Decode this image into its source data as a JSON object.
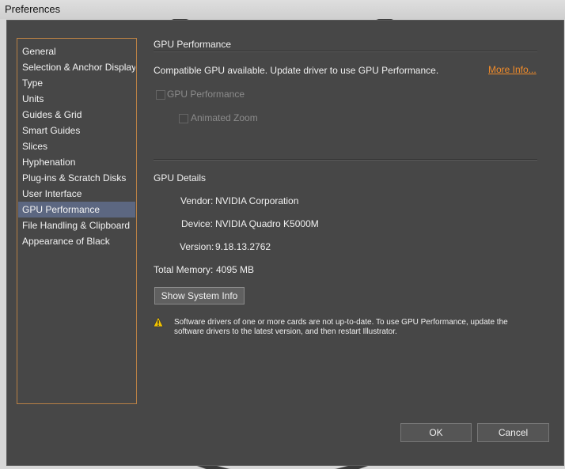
{
  "window": {
    "title": "Preferences"
  },
  "sidebar": {
    "items": [
      {
        "label": "General"
      },
      {
        "label": "Selection & Anchor Display"
      },
      {
        "label": "Type"
      },
      {
        "label": "Units"
      },
      {
        "label": "Guides & Grid"
      },
      {
        "label": "Smart Guides"
      },
      {
        "label": "Slices"
      },
      {
        "label": "Hyphenation"
      },
      {
        "label": "Plug-ins & Scratch Disks"
      },
      {
        "label": "User Interface"
      },
      {
        "label": "GPU Performance",
        "selected": true
      },
      {
        "label": "File Handling & Clipboard"
      },
      {
        "label": "Appearance of Black"
      }
    ]
  },
  "main": {
    "section_title": "GPU Performance",
    "compat_message": "Compatible GPU available. Update driver to use GPU Performance.",
    "more_info": "More Info...",
    "gpu_performance_checkbox": "GPU Performance",
    "animated_zoom_checkbox": "Animated Zoom",
    "gpu_details_title": "GPU Details",
    "vendor_label": "Vendor:",
    "vendor_value": "NVIDIA Corporation",
    "device_label": "Device:",
    "device_value": "NVIDIA Quadro K5000M",
    "version_label": "Version:",
    "version_value": "9.18.13.2762",
    "memory_label": "Total Memory:",
    "memory_value": "4095 MB",
    "show_system_info": "Show System Info",
    "warning_line1": "Software drivers of one or more cards are not up-to-date. To use GPU Performance, update the",
    "warning_line2": "software drivers to the latest version, and then restart Illustrator."
  },
  "buttons": {
    "ok": "OK",
    "cancel": "Cancel"
  },
  "colors": {
    "accent": "#f08b2a",
    "selection": "#5c6781",
    "dialog_bg": "#474747"
  },
  "icons": {
    "warning": "warning-icon"
  }
}
